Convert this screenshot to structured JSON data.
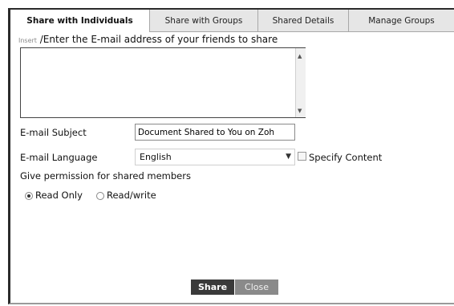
{
  "tabs": [
    {
      "label": "Share with Individuals",
      "active": true
    },
    {
      "label": "Share with Groups",
      "active": false
    },
    {
      "label": "Shared Details",
      "active": false
    },
    {
      "label": "Manage Groups",
      "active": false
    }
  ],
  "emails": {
    "insert_link": "Insert",
    "instruction": " /Enter the E-mail address of your friends to share",
    "value": ""
  },
  "subject": {
    "label": "E-mail Subject",
    "value": "Document Shared to You on Zoh"
  },
  "language": {
    "label": "E-mail Language",
    "selected": "English",
    "specify_content_label": "Specify Content"
  },
  "permissions": {
    "title": "Give permission for shared members",
    "options": [
      {
        "label": "Read Only",
        "checked": true
      },
      {
        "label": "Read/write",
        "checked": false
      }
    ]
  },
  "buttons": {
    "share": "Share",
    "close": "Close"
  }
}
